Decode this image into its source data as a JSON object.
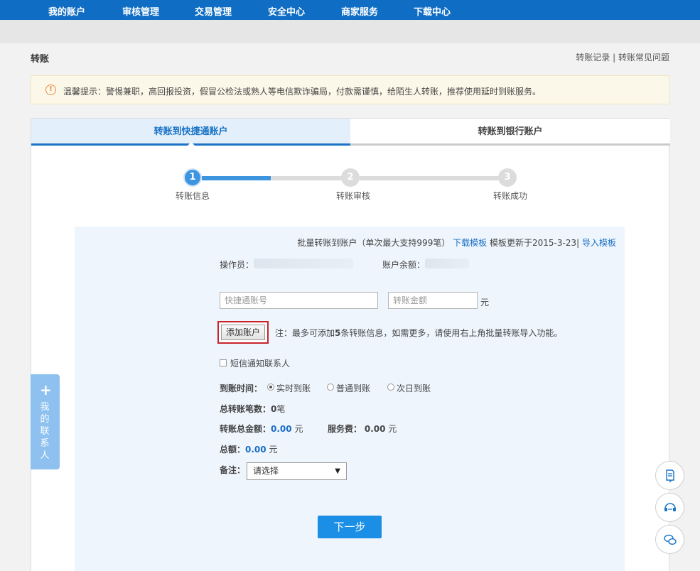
{
  "nav": {
    "items": [
      "我的账户",
      "审核管理",
      "交易管理",
      "安全中心",
      "商家服务",
      "下载中心"
    ]
  },
  "page": {
    "title": "转账",
    "links": {
      "records": "转账记录",
      "sep": " | ",
      "faq": "转账常见问题"
    }
  },
  "notice": {
    "icon": "warning-icon",
    "text": "温馨提示：警惕兼职，高回报投资，假冒公检法或熟人等电信欺诈骗局，付款需谨慎，给陌生人转账，推荐使用延时到账服务。"
  },
  "tabs": [
    {
      "label": "转账到快捷通账户",
      "active": true
    },
    {
      "label": "转账到银行账户",
      "active": false
    }
  ],
  "steps": [
    {
      "num": "1",
      "label": "转账信息"
    },
    {
      "num": "2",
      "label": "转账审核"
    },
    {
      "num": "3",
      "label": "转账成功"
    }
  ],
  "batch": {
    "text": "批量转账到账户（单次最大支持999笔）",
    "download": "下载模板",
    "updated": "模板更新于2015-3-23|",
    "import": "导入模板"
  },
  "form": {
    "operator_label": "操作员：",
    "balance_label": "账户余额：",
    "account_placeholder": "快捷通账号",
    "amount_placeholder": "转账金额",
    "currency": "元",
    "add_button": "添加账户",
    "note": "注：最多可添加",
    "note_count": "5",
    "note_rest": "条转账信息，如需更多，请使用右上角批量转账导入功能。",
    "sms_label": "短信通知联系人",
    "arrival_label": "到账时间：",
    "arrival_options": [
      "实时到账",
      "普通到账",
      "次日到账"
    ],
    "total_count_label": "总转账笔数：",
    "total_count_value": "0",
    "total_count_unit": "笔",
    "total_amount_label": "转账总金额：",
    "total_amount_value": "0.00",
    "total_amount_unit": "元",
    "fee_label": "服务费：",
    "fee_value": "0.00",
    "fee_unit": "元",
    "grand_label": "总额：",
    "grand_value": "0.00",
    "grand_unit": "元",
    "remark_label": "备注：",
    "remark_value": "请选择",
    "next_button": "下一步"
  },
  "side": {
    "contacts_plus": "+",
    "contacts_text": "我的联系人"
  },
  "colors": {
    "nav": "#0f6dc4",
    "accent": "#1a73c6",
    "button": "#1b8fe6",
    "highlight_border": "#c8242a"
  }
}
